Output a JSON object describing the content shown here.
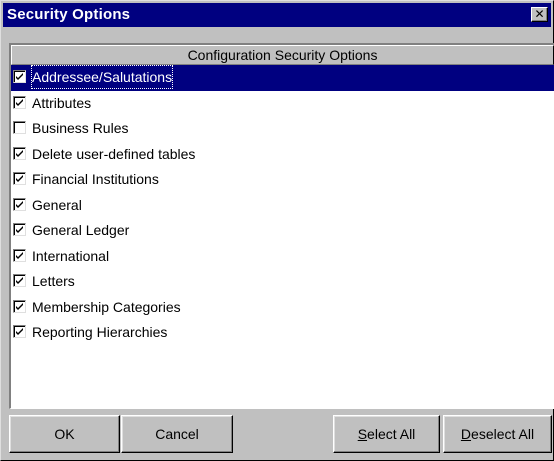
{
  "window": {
    "title": "Security Options",
    "close_symbol": "✕"
  },
  "list": {
    "header": "Configuration Security Options",
    "items": [
      {
        "label": "Addressee/Salutations",
        "checked": true,
        "selected": true
      },
      {
        "label": "Attributes",
        "checked": true,
        "selected": false
      },
      {
        "label": "Business Rules",
        "checked": false,
        "selected": false
      },
      {
        "label": "Delete user-defined tables",
        "checked": true,
        "selected": false
      },
      {
        "label": "Financial Institutions",
        "checked": true,
        "selected": false
      },
      {
        "label": "General",
        "checked": true,
        "selected": false
      },
      {
        "label": "General Ledger",
        "checked": true,
        "selected": false
      },
      {
        "label": "International",
        "checked": true,
        "selected": false
      },
      {
        "label": "Letters",
        "checked": true,
        "selected": false
      },
      {
        "label": "Membership Categories",
        "checked": true,
        "selected": false
      },
      {
        "label": "Reporting Hierarchies",
        "checked": true,
        "selected": false
      }
    ]
  },
  "buttons": {
    "ok": "OK",
    "cancel": "Cancel",
    "select_all_mnemonic": "S",
    "select_all_rest": "elect All",
    "deselect_all_mnemonic": "D",
    "deselect_all_rest": "eselect All"
  },
  "colors": {
    "title_bar": "#000080",
    "selection": "#000080",
    "face": "#c0c0c0"
  }
}
